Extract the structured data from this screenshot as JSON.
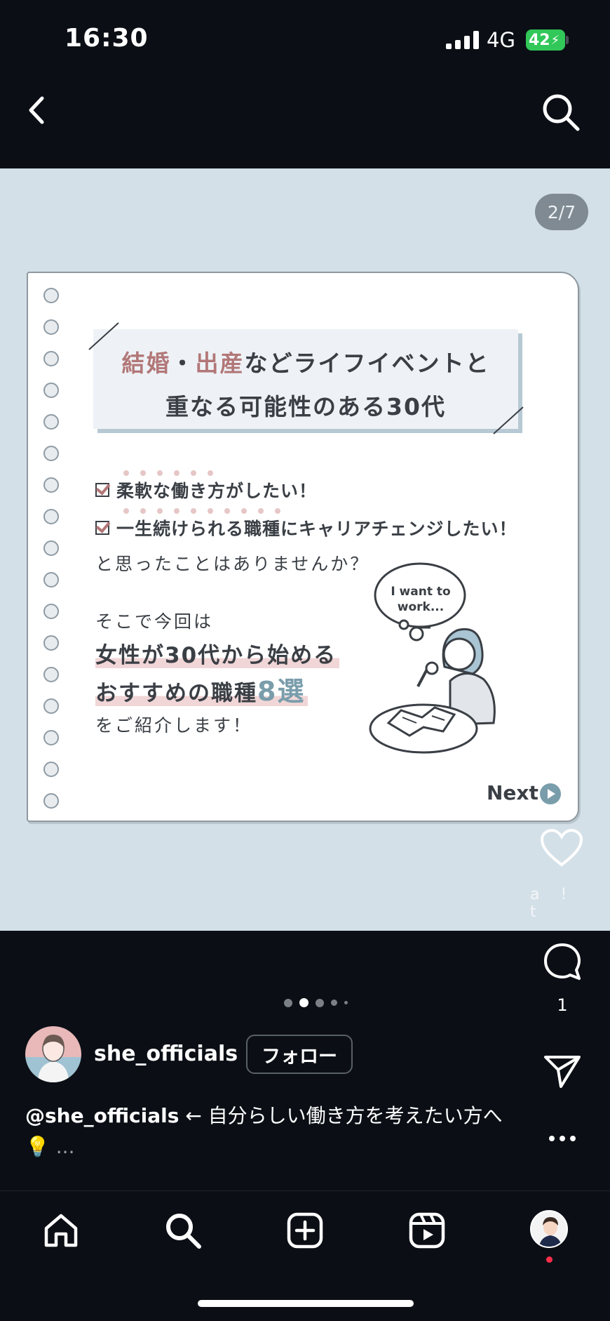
{
  "status_bar": {
    "time": "16:30",
    "network": "4G",
    "battery": "42"
  },
  "post": {
    "page_indicator": "2/7",
    "card": {
      "title_line1_part1": "結婚",
      "title_line1_sep": "・",
      "title_line1_part2": "出産",
      "title_line1_part3": "などライフイベントと",
      "title_line2": "重なる可能性のある30代",
      "checklist": [
        "柔軟な働き方がしたい！",
        "一生続けられる職種にキャリアチェンジしたい！"
      ],
      "question": "と思ったことはありませんか？",
      "intro": "そこで今回は",
      "headline1": "女性が30代から始める",
      "headline2_part1": "おすすめの職種",
      "headline2_number": "8選",
      "outro": "をご紹介します！",
      "bubble_line1": "I want to",
      "bubble_line2": "work...",
      "next_label": "Next"
    }
  },
  "actions": {
    "comment_count": "1"
  },
  "author": {
    "username": "she_officials",
    "follow_label": "フォロー"
  },
  "caption": {
    "handle": "@she_officials",
    "text": " ← 自分らしい働き方を考えたい方へ💡",
    "more": " ..."
  },
  "carousel_dots": {
    "count": 5,
    "active_index": 1
  },
  "colors": {
    "background": "#0b0f15",
    "post_bg": "#d4e0e8",
    "accent_rose": "#b27778",
    "accent_blue": "#7a9dab"
  }
}
